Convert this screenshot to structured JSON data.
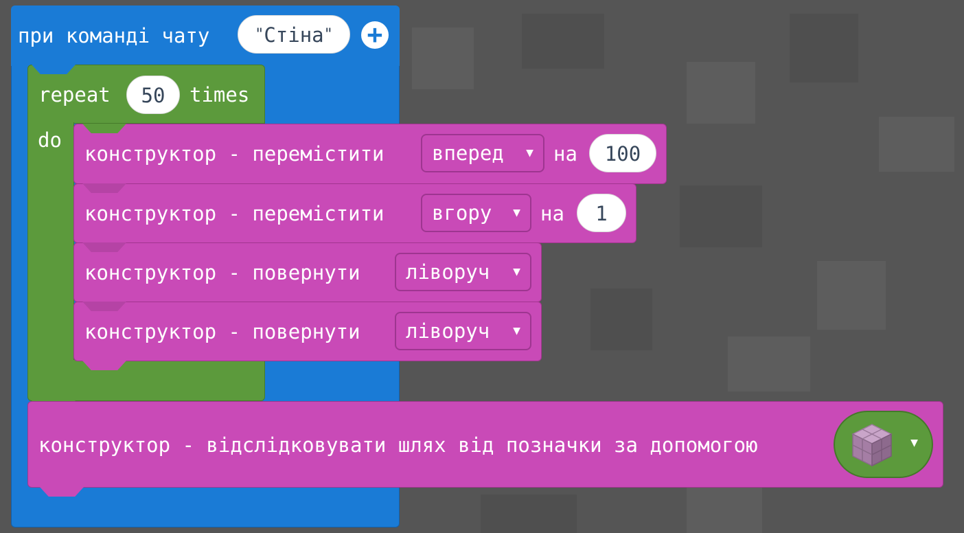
{
  "event_block": {
    "label": "при команді чату",
    "command_value": "Стіна",
    "quote_open": "\"",
    "quote_close": "\"",
    "add_icon": "plus-circle-icon"
  },
  "repeat_block": {
    "label_repeat": "repeat",
    "count": "50",
    "label_times": "times",
    "label_do": "do"
  },
  "builder_blocks": [
    {
      "label": "конструктор - перемістити",
      "direction": "вперед",
      "label_by": "на",
      "amount": "100"
    },
    {
      "label": "конструктор - перемістити",
      "direction": "вгору",
      "label_by": "на",
      "amount": "1"
    },
    {
      "label": "конструктор - повернути",
      "direction": "ліворуч"
    },
    {
      "label": "конструктор - повернути",
      "direction": "ліворуч"
    }
  ],
  "trace_block": {
    "label": "конструктор - відслідковувати шлях від позначки за допомогою",
    "block_icon": "purpur-block-icon"
  },
  "dropdown_icon": "caret-down-icon",
  "colors": {
    "event_blue": "#1a7bd6",
    "loop_green": "#5c9a3c",
    "builder_pink": "#c94ab7",
    "background": "#555555"
  }
}
